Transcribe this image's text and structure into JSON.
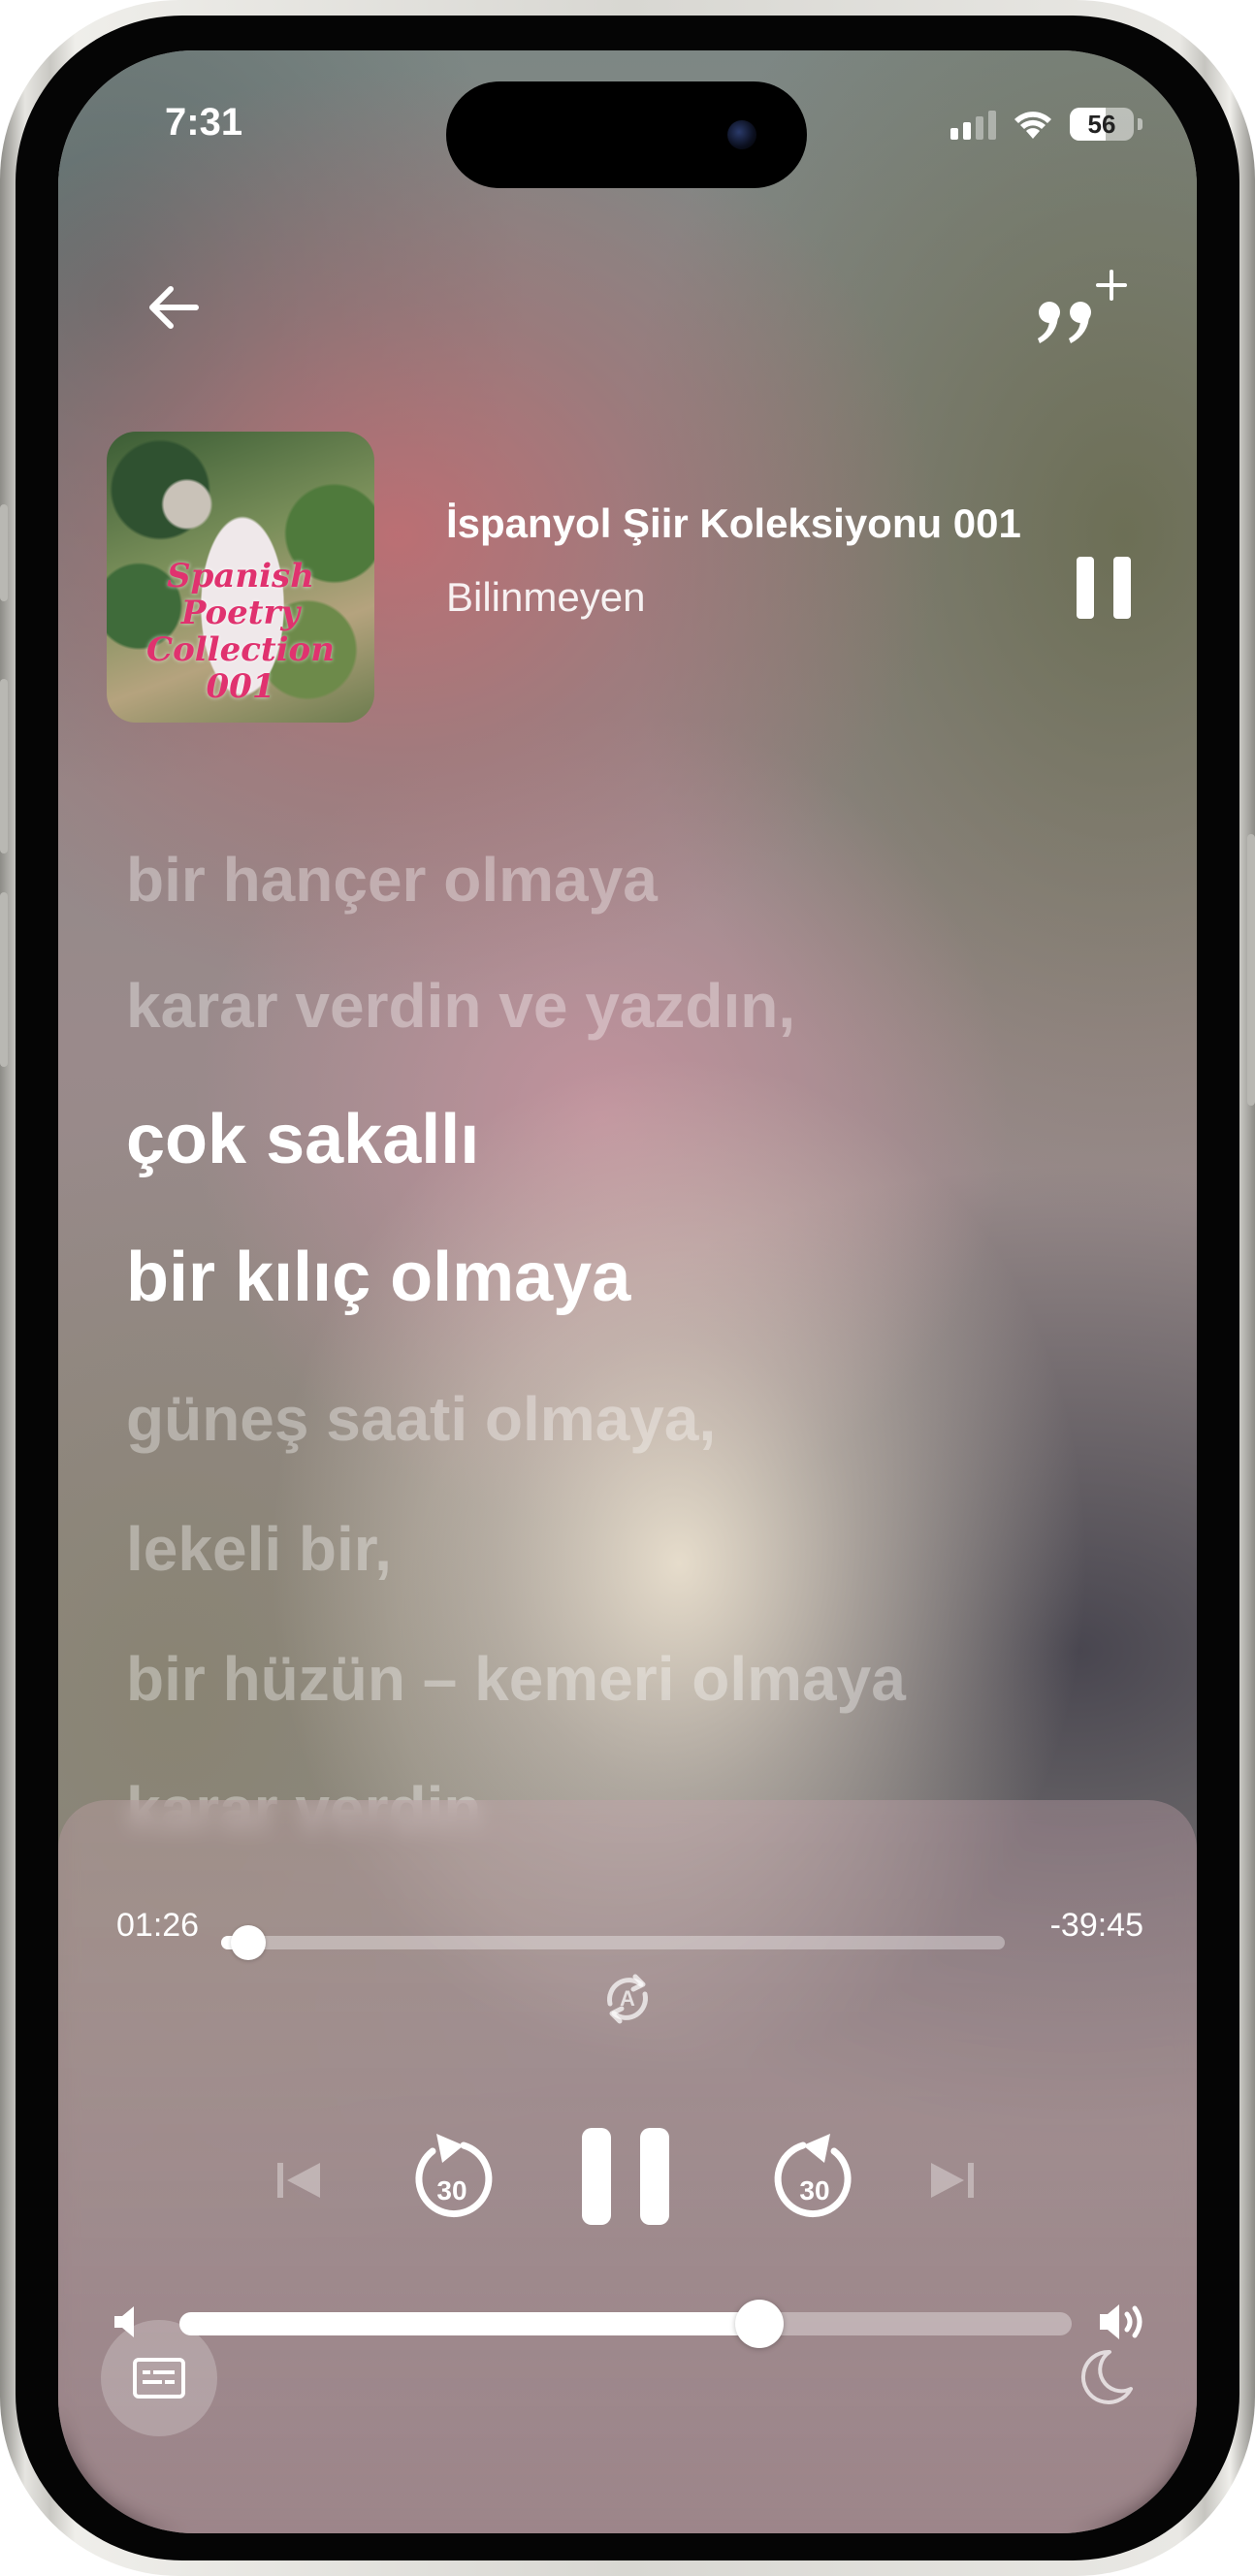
{
  "status_bar": {
    "time": "7:31",
    "battery": "56"
  },
  "now_playing": {
    "cover_text": "Spanish Poetry Collection 001",
    "title": "İspanyol Şiir Koleksiyonu 001",
    "artist": "Bilinmeyen"
  },
  "lyrics": [
    {
      "text": "bir hançer olmaya",
      "active": false
    },
    {
      "text": "karar verdin ve yazdın,",
      "active": false
    },
    {
      "text": "çok sakallı",
      "active": true
    },
    {
      "text": "bir kılıç olmaya",
      "active": true
    },
    {
      "text": "güneş saati olmaya,",
      "active": false
    },
    {
      "text": "lekeli bir,",
      "active": false
    },
    {
      "text": "bir hüzün – kemeri olmaya",
      "active": false
    },
    {
      "text": "karar verdin",
      "active": false
    }
  ],
  "playback": {
    "elapsed": "01:26",
    "remaining": "-39:45",
    "progress_fraction": 0.035,
    "rewind_label": "30",
    "forward_label": "30",
    "volume_fraction": 0.65
  },
  "icons": {
    "back": "arrow-left-icon",
    "add_quote": "quote-plus-icon",
    "autoplay": "autoplay-icon",
    "captions": "captions-icon",
    "sleep_timer": "moon-icon"
  },
  "colors": {
    "accent": "#ffffff",
    "cover_title": "#e0326f"
  }
}
